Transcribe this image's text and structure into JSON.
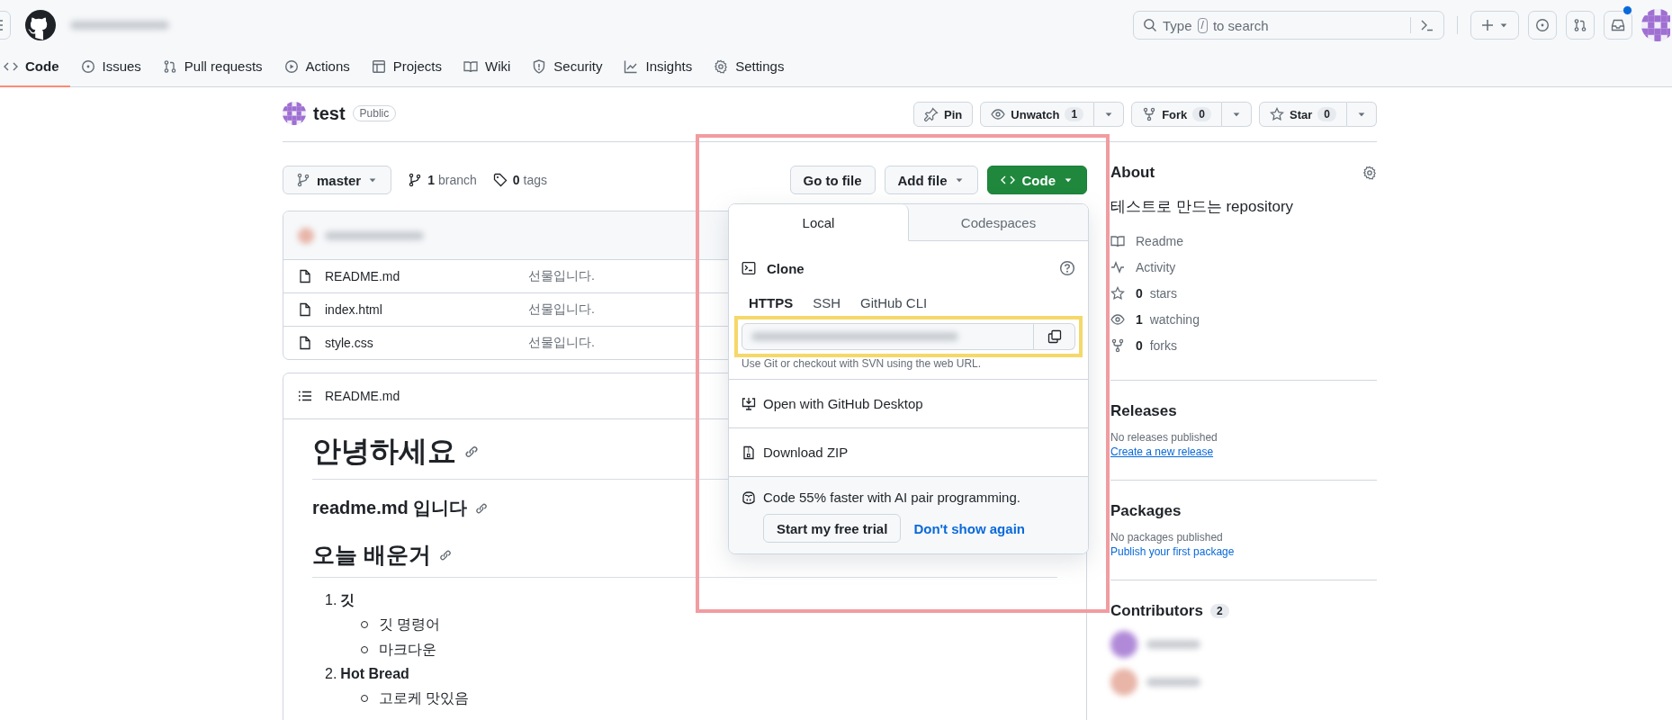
{
  "top_bar": {
    "search": {
      "before": "Type",
      "key": "/",
      "after": "to search"
    },
    "notifications": {
      "unread": true
    }
  },
  "repo_tabs": [
    {
      "label": "Code",
      "selected": true
    },
    {
      "label": "Issues",
      "selected": false
    },
    {
      "label": "Pull requests",
      "selected": false
    },
    {
      "label": "Actions",
      "selected": false
    },
    {
      "label": "Projects",
      "selected": false
    },
    {
      "label": "Wiki",
      "selected": false
    },
    {
      "label": "Security",
      "selected": false
    },
    {
      "label": "Insights",
      "selected": false
    },
    {
      "label": "Settings",
      "selected": false
    }
  ],
  "repo": {
    "name": "test",
    "visibility": "Public"
  },
  "repo_actions": [
    {
      "label": "Pin",
      "kind": "plain"
    },
    {
      "label": "Unwatch",
      "count": "1",
      "kind": "split"
    },
    {
      "label": "Fork",
      "count": "0",
      "kind": "split"
    },
    {
      "label": "Star",
      "count": "0",
      "kind": "split"
    }
  ],
  "branch": {
    "name": "master",
    "branches": {
      "count": "1",
      "label": "branch"
    },
    "tags": {
      "count": "0",
      "label": "tags"
    }
  },
  "file_buttons": [
    {
      "label": "Go to file",
      "kind": "plain"
    },
    {
      "label": "Add file",
      "kind": "menu"
    },
    {
      "label": "Code",
      "kind": "primary"
    }
  ],
  "files": [
    {
      "name": "README.md",
      "message": "선물입니다."
    },
    {
      "name": "index.html",
      "message": "선물입니다."
    },
    {
      "name": "style.css",
      "message": "선물입니다."
    }
  ],
  "readme": {
    "title": "README.md",
    "blocks": [
      {
        "kind": "h1",
        "text": "안녕하세요"
      },
      {
        "kind": "h3",
        "text": "readme.md 입니다"
      },
      {
        "kind": "h2",
        "text": "오늘 배운거"
      },
      {
        "kind": "ol",
        "items": [
          {
            "number": "1.",
            "text": "깃",
            "children": [
              {
                "text": "깃 명령어"
              },
              {
                "text": "마크다운"
              }
            ]
          },
          {
            "number": "2.",
            "text": "Hot Bread",
            "children": [
              {
                "text": "고로케 맛있음"
              }
            ]
          }
        ]
      }
    ]
  },
  "clone_menu": {
    "tabs": [
      {
        "label": "Local",
        "selected": true
      },
      {
        "label": "Codespaces",
        "selected": false
      }
    ],
    "title": "Clone",
    "protocols": [
      {
        "label": "HTTPS",
        "selected": true
      },
      {
        "label": "SSH",
        "selected": false
      },
      {
        "label": "GitHub CLI",
        "selected": false
      }
    ],
    "hint": "Use Git or checkout with SVN using the web URL.",
    "actions": [
      {
        "label": "Open with GitHub Desktop"
      },
      {
        "label": "Download ZIP"
      }
    ],
    "promo": {
      "text": "Code 55% faster with AI pair programming.",
      "buttons": [
        {
          "label": "Start my free trial",
          "kind": "secondary"
        },
        {
          "label": "Don't show again",
          "kind": "link"
        }
      ]
    }
  },
  "about": {
    "title": "About",
    "description": "테스트로 만드는 repository",
    "links": [
      {
        "label": "Readme"
      },
      {
        "label": "Activity"
      },
      {
        "count": "0",
        "label": "stars"
      },
      {
        "count": "1",
        "label": "watching"
      },
      {
        "count": "0",
        "label": "forks"
      }
    ]
  },
  "sections": [
    {
      "title": "Releases",
      "text": "No releases published",
      "link": "Create a new release"
    },
    {
      "title": "Packages",
      "text": "No packages published",
      "link": "Publish your first package"
    }
  ],
  "contributors": {
    "title": "Contributors",
    "count": "2"
  },
  "annotations": [
    {
      "color": "#f19ca0"
    },
    {
      "color": "#f5d86a"
    }
  ]
}
